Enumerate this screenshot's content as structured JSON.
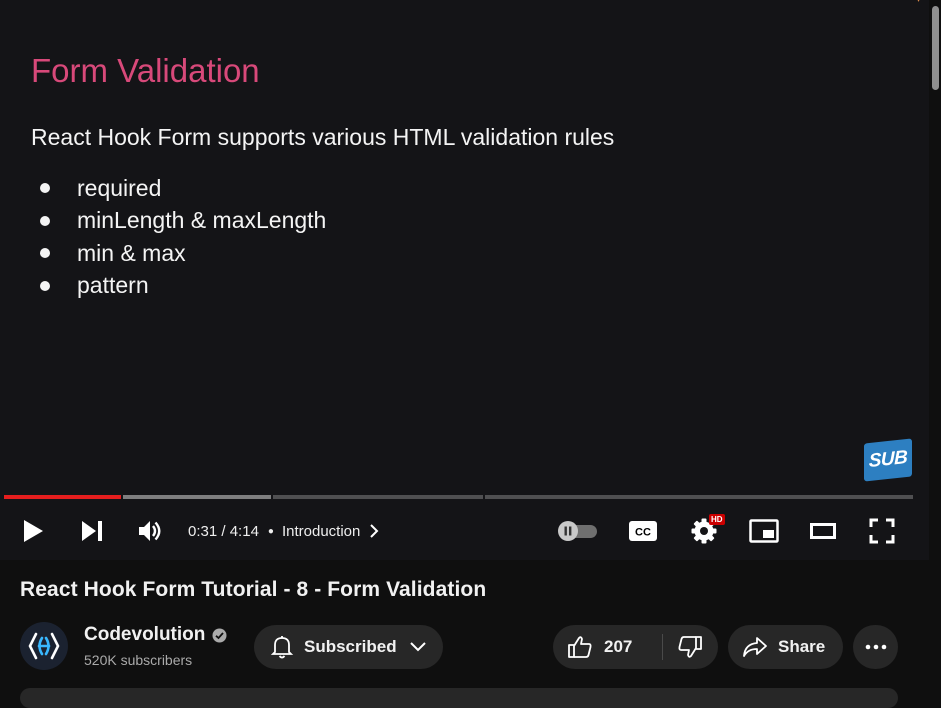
{
  "slide": {
    "title": "Form Validation",
    "intro": "React Hook Form supports various HTML validation rules",
    "bullets": [
      "required",
      "minLength & maxLength",
      "min & max",
      "pattern"
    ],
    "watermark": "SUB"
  },
  "player": {
    "progress_fraction": 0.125,
    "time_current": "0:31",
    "time_separator": " / ",
    "time_total": "4:14",
    "chapter": "Introduction",
    "settings_badge": "HD",
    "accent_color": "#e61e1e",
    "icons": [
      "play-icon",
      "next-icon",
      "volume-icon",
      "chevron-right-icon",
      "autoplay-toggle-icon",
      "cc-icon",
      "gear-icon",
      "miniplayer-icon",
      "theater-icon",
      "fullscreen-icon"
    ]
  },
  "video": {
    "title": "React Hook Form Tutorial - 8 - Form Validation"
  },
  "channel": {
    "name": "Codevolution",
    "subscribers": "520K subscribers"
  },
  "actions": {
    "subscribe_label": "Subscribed",
    "like_count": "207",
    "share_label": "Share"
  }
}
